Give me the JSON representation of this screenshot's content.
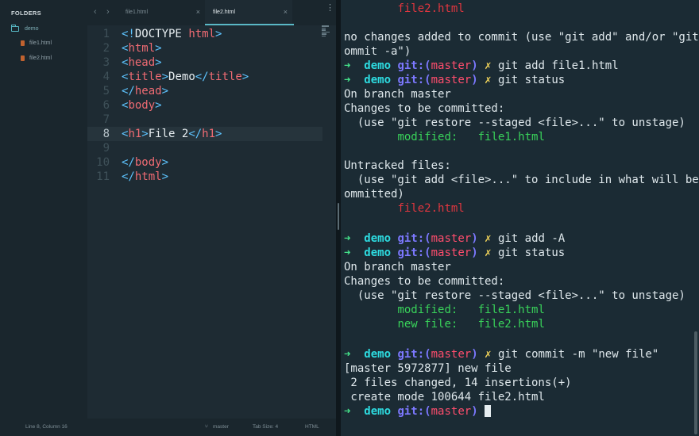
{
  "sidebar": {
    "header": "FOLDERS",
    "folder": "demo",
    "files": [
      "file1.html",
      "file2.html"
    ]
  },
  "tabs": {
    "back_arrow": "‹",
    "forward_arrow": "›",
    "items": [
      {
        "label": "file1.html",
        "close": "×"
      },
      {
        "label": "file2.html",
        "close": "×"
      }
    ],
    "more": "⋮"
  },
  "editor": {
    "line_numbers": [
      "1",
      "2",
      "3",
      "4",
      "5",
      "6",
      "7",
      "8",
      "9",
      "10",
      "11"
    ],
    "current_line": 8,
    "lines": [
      "<!DOCTYPE html>",
      "<html>",
      "<head>",
      "<title>Demo</title>",
      "</head>",
      "<body>",
      "",
      "<h1>File 2</h1>",
      "",
      "</body>",
      "</html>"
    ]
  },
  "statusbar": {
    "cursor_position": "Line 8, Column 16",
    "branch": "master",
    "tab_size": "Tab Size: 4",
    "syntax": "HTML"
  },
  "terminal": {
    "prompt": {
      "arrow": "➜",
      "dir": "demo",
      "git_prefix": "git:(",
      "branch": "master",
      "git_suffix": ")",
      "dirty": "✗"
    },
    "lines": {
      "l01": "file2.html",
      "l03": "no changes added to commit (use \"git add\" and/or \"git c",
      "l04": "ommit -a\")",
      "l05_cmd": "git add file1.html",
      "l06_cmd": "git status",
      "l07": "On branch master",
      "l08": "Changes to be committed:",
      "l09": "  (use \"git restore --staged <file>...\" to unstage)",
      "l10": "modified:   file1.html",
      "l12": "Untracked files:",
      "l13": "  (use \"git add <file>...\" to include in what will be c",
      "l14": "ommitted)",
      "l15": "file2.html",
      "l17_cmd": "git add -A",
      "l18_cmd": "git status",
      "l19": "On branch master",
      "l20": "Changes to be committed:",
      "l21": "  (use \"git restore --staged <file>...\" to unstage)",
      "l22": "modified:   file1.html",
      "l23": "new file:   file2.html",
      "l25_cmd": "git commit -m \"new file\"",
      "l26": "[master 5972877] new file",
      "l27": " 2 files changed, 14 insertions(+)",
      "l28": " create mode 100644 file2.html"
    }
  }
}
